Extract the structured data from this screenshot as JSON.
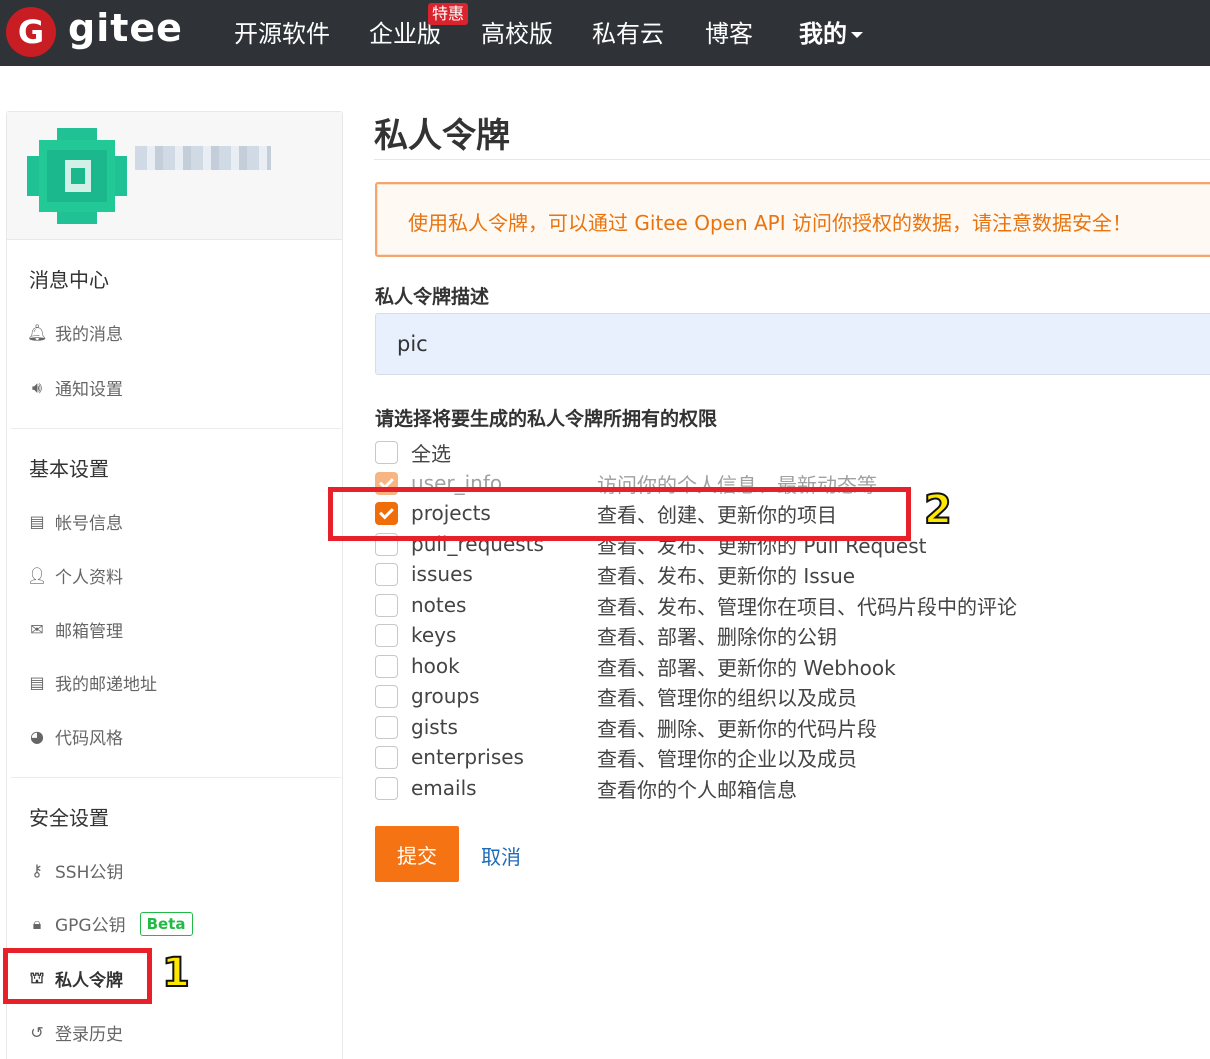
{
  "brand": {
    "name": "gitee",
    "logo_letter": "G"
  },
  "nav": {
    "items": [
      "开源软件",
      "企业版",
      "高校版",
      "私有云",
      "博客",
      "我的"
    ],
    "hot_badge": "特惠"
  },
  "sidebar": {
    "sections": [
      {
        "title": "消息中心",
        "items": [
          {
            "label": "我的消息",
            "icon": "bell-icon"
          },
          {
            "label": "通知设置",
            "icon": "speaker-icon"
          }
        ]
      },
      {
        "title": "基本设置",
        "items": [
          {
            "label": "帐号信息",
            "icon": "id-card-icon"
          },
          {
            "label": "个人资料",
            "icon": "user-icon"
          },
          {
            "label": "邮箱管理",
            "icon": "mail-icon"
          },
          {
            "label": "我的邮递地址",
            "icon": "address-card-icon"
          },
          {
            "label": "代码风格",
            "icon": "palette-icon"
          }
        ]
      },
      {
        "title": "安全设置",
        "items": [
          {
            "label": "SSH公钥",
            "icon": "key-icon"
          },
          {
            "label": "GPG公钥",
            "icon": "lock-icon",
            "badge": "Beta"
          },
          {
            "label": "私人令牌",
            "icon": "token-icon",
            "active": true
          },
          {
            "label": "登录历史",
            "icon": "history-icon"
          }
        ]
      }
    ]
  },
  "main": {
    "title": "私人令牌",
    "warning": "使用私人令牌，可以通过 Gitee Open API 访问你授权的数据，请注意数据安全！",
    "desc_label": "私人令牌描述",
    "desc_value": "pic",
    "perm_label": "请选择将要生成的私人令牌所拥有的权限",
    "select_all": "全选",
    "permissions": [
      {
        "name": "user_info",
        "desc": "访问你的个人信息、最新动态等",
        "checked": true,
        "disabled": true
      },
      {
        "name": "projects",
        "desc": "查看、创建、更新你的项目",
        "checked": true
      },
      {
        "name": "pull_requests",
        "desc": "查看、发布、更新你的 Pull Request",
        "checked": false
      },
      {
        "name": "issues",
        "desc": "查看、发布、更新你的 Issue",
        "checked": false
      },
      {
        "name": "notes",
        "desc": "查看、发布、管理你在项目、代码片段中的评论",
        "checked": false
      },
      {
        "name": "keys",
        "desc": "查看、部署、删除你的公钥",
        "checked": false
      },
      {
        "name": "hook",
        "desc": "查看、部署、更新你的 Webhook",
        "checked": false
      },
      {
        "name": "groups",
        "desc": "查看、管理你的组织以及成员",
        "checked": false
      },
      {
        "name": "gists",
        "desc": "查看、删除、更新你的代码片段",
        "checked": false
      },
      {
        "name": "enterprises",
        "desc": "查看、管理你的企业以及成员",
        "checked": false
      },
      {
        "name": "emails",
        "desc": "查看你的个人邮箱信息",
        "checked": false
      }
    ],
    "submit_label": "提交",
    "cancel_label": "取消"
  },
  "annotations": [
    "1",
    "2"
  ]
}
